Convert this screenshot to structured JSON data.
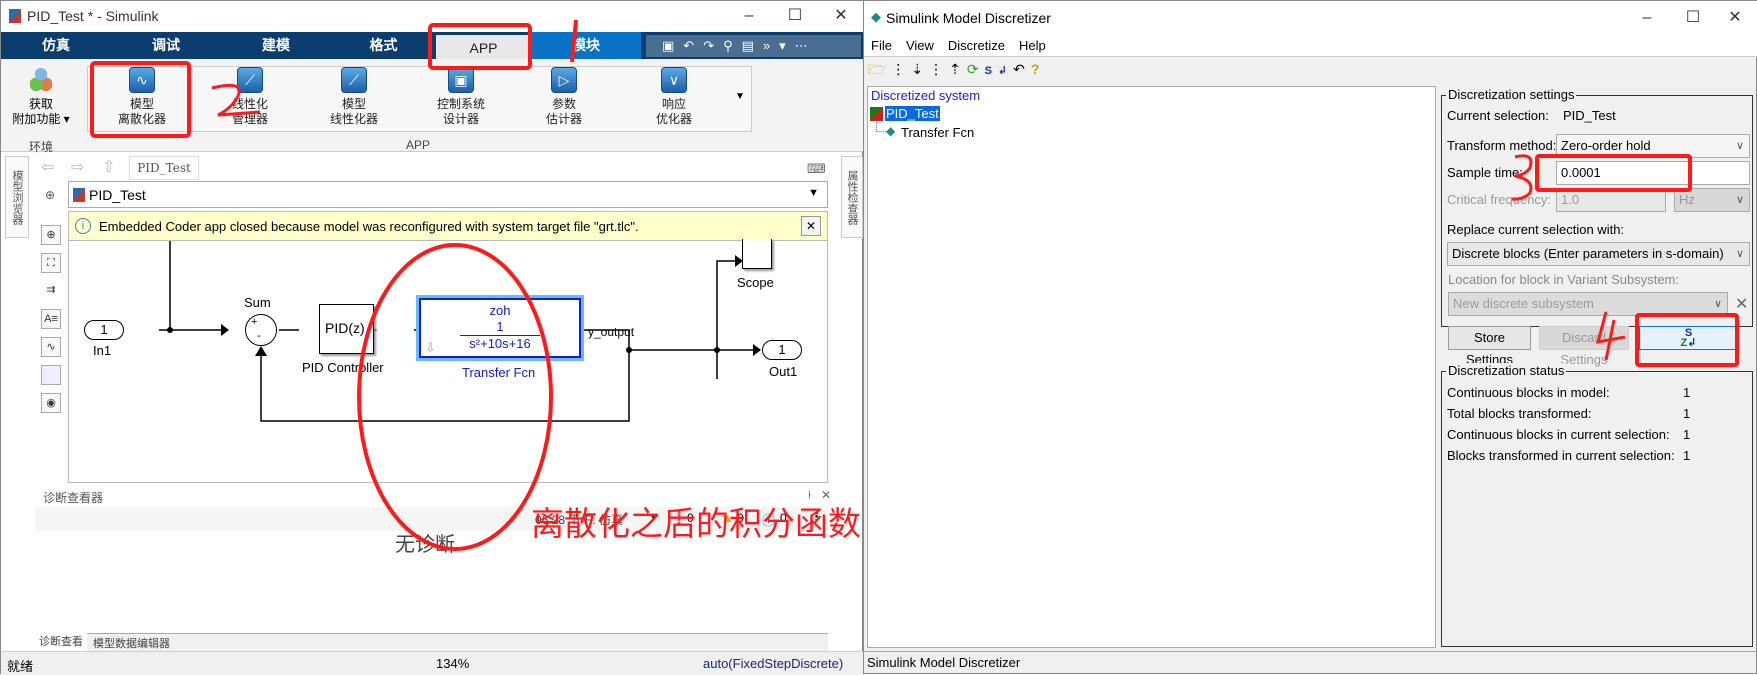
{
  "simulink": {
    "title": "PID_Test * - Simulink",
    "tabs": [
      "仿真",
      "调试",
      "建模",
      "格式",
      "APP",
      "模块"
    ],
    "env": {
      "label1": "获取",
      "label2": "附加功能 ▾",
      "group": "环境"
    },
    "apps": [
      {
        "l1": "模型",
        "l2": "离散化器",
        "icon": "discretizer-icon"
      },
      {
        "l1": "线性化",
        "l2": "管理器",
        "icon": "linearization-manager-icon"
      },
      {
        "l1": "模型",
        "l2": "线性化器",
        "icon": "model-linearizer-icon"
      },
      {
        "l1": "控制系统",
        "l2": "设计器",
        "icon": "control-designer-icon"
      },
      {
        "l1": "参数",
        "l2": "估计器",
        "icon": "parameter-estimator-icon"
      },
      {
        "l1": "响应",
        "l2": "优化器",
        "icon": "response-optimizer-icon"
      }
    ],
    "apps_group": "APP",
    "breadcrumb_tab": "PID_Test",
    "model_path": "PID_Test",
    "left_panel": "模型浏览器",
    "right_panel": "属性检查器",
    "notification": "Embedded Coder app closed because model was reconfigured with system target file \"grt.tlc\".",
    "diagram": {
      "in1_num": "1",
      "in1": "In1",
      "sum": "Sum",
      "plus": "+",
      "minus": "-",
      "pid": "PID(z)",
      "pid_label": "PID Controller",
      "tf_zoh": "zoh",
      "tf_num": "1",
      "tf_den": "s²+10s+16",
      "tf_label": "Transfer Fcn",
      "signal": "y_output",
      "scope": "Scope",
      "out1_num": "1",
      "out1": "Out1"
    },
    "diag": {
      "title": "诊断查看器",
      "time": "06:28 下午: 仿真",
      "errors": "0",
      "warnings": "0",
      "infos": "0",
      "empty": "无诊断",
      "tabs": [
        "诊断查看器",
        "模型数据编辑器"
      ]
    },
    "status": {
      "ready": "就绪",
      "zoom": "134%",
      "solver": "auto(FixedStepDiscrete)"
    }
  },
  "discretizer": {
    "title": "Simulink Model Discretizer",
    "menu": [
      "File",
      "View",
      "Discretize",
      "Help"
    ],
    "tree": {
      "header": "Discretized system",
      "root": "PID_Test",
      "child": "Transfer Fcn"
    },
    "settings": {
      "legend": "Discretization settings",
      "current_label": "Current selection:",
      "current_value": "PID_Test",
      "method_label": "Transform method:",
      "method_value": "Zero-order hold",
      "sample_label": "Sample time:",
      "sample_value": "0.0001",
      "crit_label": "Critical frequency:",
      "crit_value": "1.0",
      "crit_unit": "Hz",
      "replace_label": "Replace current selection with:",
      "replace_value": "Discrete blocks (Enter parameters in s-domain)",
      "variant_label": "Location for block in Variant Subsystem:",
      "variant_value": "New discrete subsystem",
      "store": "Store Settings",
      "discard": "Discard Settings"
    },
    "status": {
      "legend": "Discretization status",
      "rows": [
        {
          "label": "Continuous blocks in model:",
          "value": "1"
        },
        {
          "label": "Total blocks transformed:",
          "value": "1"
        },
        {
          "label": "Continuous blocks in current selection:",
          "value": "1"
        },
        {
          "label": "Blocks transformed in current selection:",
          "value": "1"
        }
      ]
    },
    "statusbar": "Simulink Model Discretizer"
  },
  "annotations": {
    "caption": "离散化之后的积分函数",
    "steps": [
      "1",
      "2",
      "3",
      "4"
    ],
    "color": "#ff1a1a"
  }
}
